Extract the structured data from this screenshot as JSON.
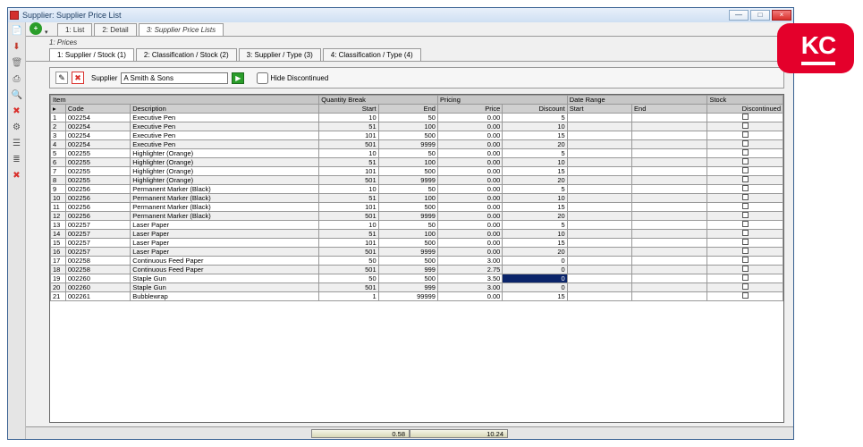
{
  "window": {
    "title": "Supplier: Supplier Price List"
  },
  "winbtns": {
    "min": "—",
    "max": "□",
    "close": "×"
  },
  "sidebar_icons": [
    {
      "g": "📄",
      "c": "#c0392b",
      "name": "pdf-icon"
    },
    {
      "g": "⬇",
      "c": "#c0392b",
      "name": "download-icon"
    },
    {
      "g": "🗑",
      "c": "#777",
      "name": "trash-icon"
    },
    {
      "g": "⎙",
      "c": "#555",
      "name": "print-icon"
    },
    {
      "g": "🔍",
      "c": "#555",
      "name": "find-icon"
    },
    {
      "g": "✖",
      "c": "#d9302c",
      "name": "delete-icon"
    },
    {
      "g": "⚙",
      "c": "#555",
      "name": "gear-icon"
    },
    {
      "g": "☰",
      "c": "#555",
      "name": "list-icon"
    },
    {
      "g": "≣",
      "c": "#555",
      "name": "lines-icon"
    },
    {
      "g": "✖",
      "c": "#d9302c",
      "name": "cancel-icon"
    }
  ],
  "top_tabs": {
    "t1": "1: List",
    "t2": "2: Detail",
    "t3": "3: Supplier Price Lists"
  },
  "sub": {
    "prices": "1: Prices"
  },
  "filter_tabs": {
    "f1": "1: Supplier / Stock (1)",
    "f2": "2: Classification / Stock (2)",
    "f3": "3: Supplier / Type (3)",
    "f4": "4: Classification / Type (4)"
  },
  "supplier": {
    "label": "Supplier",
    "value": "A Smith & Sons",
    "hide_label": "Hide Discontinued",
    "btn_new": "✎",
    "btn_del": "✖"
  },
  "grid": {
    "groups": {
      "item": "Item",
      "qty": "Quantity Break",
      "pricing": "Pricing",
      "date": "Date Range",
      "stock": "Stock"
    },
    "cols": {
      "rownum": "",
      "code": "Code",
      "desc": "Description",
      "start": "Start",
      "end": "End",
      "price": "Price",
      "discount": "Discount",
      "dstart": "Start",
      "dend": "End",
      "disc": "Discontinued"
    },
    "rows": [
      {
        "n": 1,
        "code": "002254",
        "desc": "Executive Pen",
        "s": 10,
        "e": 50,
        "p": "0.00",
        "d": 5
      },
      {
        "n": 2,
        "code": "002254",
        "desc": "Executive Pen",
        "s": 51,
        "e": 100,
        "p": "0.00",
        "d": 10
      },
      {
        "n": 3,
        "code": "002254",
        "desc": "Executive Pen",
        "s": 101,
        "e": 500,
        "p": "0.00",
        "d": 15
      },
      {
        "n": 4,
        "code": "002254",
        "desc": "Executive Pen",
        "s": 501,
        "e": 9999,
        "p": "0.00",
        "d": 20
      },
      {
        "n": 5,
        "code": "002255",
        "desc": "Highlighter (Orange)",
        "s": 10,
        "e": 50,
        "p": "0.00",
        "d": 5
      },
      {
        "n": 6,
        "code": "002255",
        "desc": "Highlighter (Orange)",
        "s": 51,
        "e": 100,
        "p": "0.00",
        "d": 10
      },
      {
        "n": 7,
        "code": "002255",
        "desc": "Highlighter (Orange)",
        "s": 101,
        "e": 500,
        "p": "0.00",
        "d": 15
      },
      {
        "n": 8,
        "code": "002255",
        "desc": "Highlighter (Orange)",
        "s": 501,
        "e": 9999,
        "p": "0.00",
        "d": 20
      },
      {
        "n": 9,
        "code": "002256",
        "desc": "Permanent Marker (Black)",
        "s": 10,
        "e": 50,
        "p": "0.00",
        "d": 5
      },
      {
        "n": 10,
        "code": "002256",
        "desc": "Permanent Marker (Black)",
        "s": 51,
        "e": 100,
        "p": "0.00",
        "d": 10
      },
      {
        "n": 11,
        "code": "002256",
        "desc": "Permanent Marker (Black)",
        "s": 101,
        "e": 500,
        "p": "0.00",
        "d": 15
      },
      {
        "n": 12,
        "code": "002256",
        "desc": "Permanent Marker (Black)",
        "s": 501,
        "e": 9999,
        "p": "0.00",
        "d": 20
      },
      {
        "n": 13,
        "code": "002257",
        "desc": "Laser Paper",
        "s": 10,
        "e": 50,
        "p": "0.00",
        "d": 5
      },
      {
        "n": 14,
        "code": "002257",
        "desc": "Laser Paper",
        "s": 51,
        "e": 100,
        "p": "0.00",
        "d": 10
      },
      {
        "n": 15,
        "code": "002257",
        "desc": "Laser Paper",
        "s": 101,
        "e": 500,
        "p": "0.00",
        "d": 15
      },
      {
        "n": 16,
        "code": "002257",
        "desc": "Laser Paper",
        "s": 501,
        "e": 9999,
        "p": "0.00",
        "d": 20
      },
      {
        "n": 17,
        "code": "002258",
        "desc": "Continuous Feed Paper",
        "s": 50,
        "e": 500,
        "p": "3.00",
        "d": 0
      },
      {
        "n": 18,
        "code": "002258",
        "desc": "Continuous Feed Paper",
        "s": 501,
        "e": 999,
        "p": "2.75",
        "d": 0
      },
      {
        "n": 19,
        "code": "002260",
        "desc": "Staple Gun",
        "s": 50,
        "e": 500,
        "p": "3.50",
        "d": 0,
        "sel": true
      },
      {
        "n": 20,
        "code": "002260",
        "desc": "Staple Gun",
        "s": 501,
        "e": 999,
        "p": "3.00",
        "d": 0
      },
      {
        "n": 21,
        "code": "002261",
        "desc": "Bubblewrap",
        "s": 1,
        "e": 99999,
        "p": "0.00",
        "d": 15
      }
    ]
  },
  "statusbar": {
    "left": "0.58",
    "right": "10.24"
  },
  "badge": "KC"
}
